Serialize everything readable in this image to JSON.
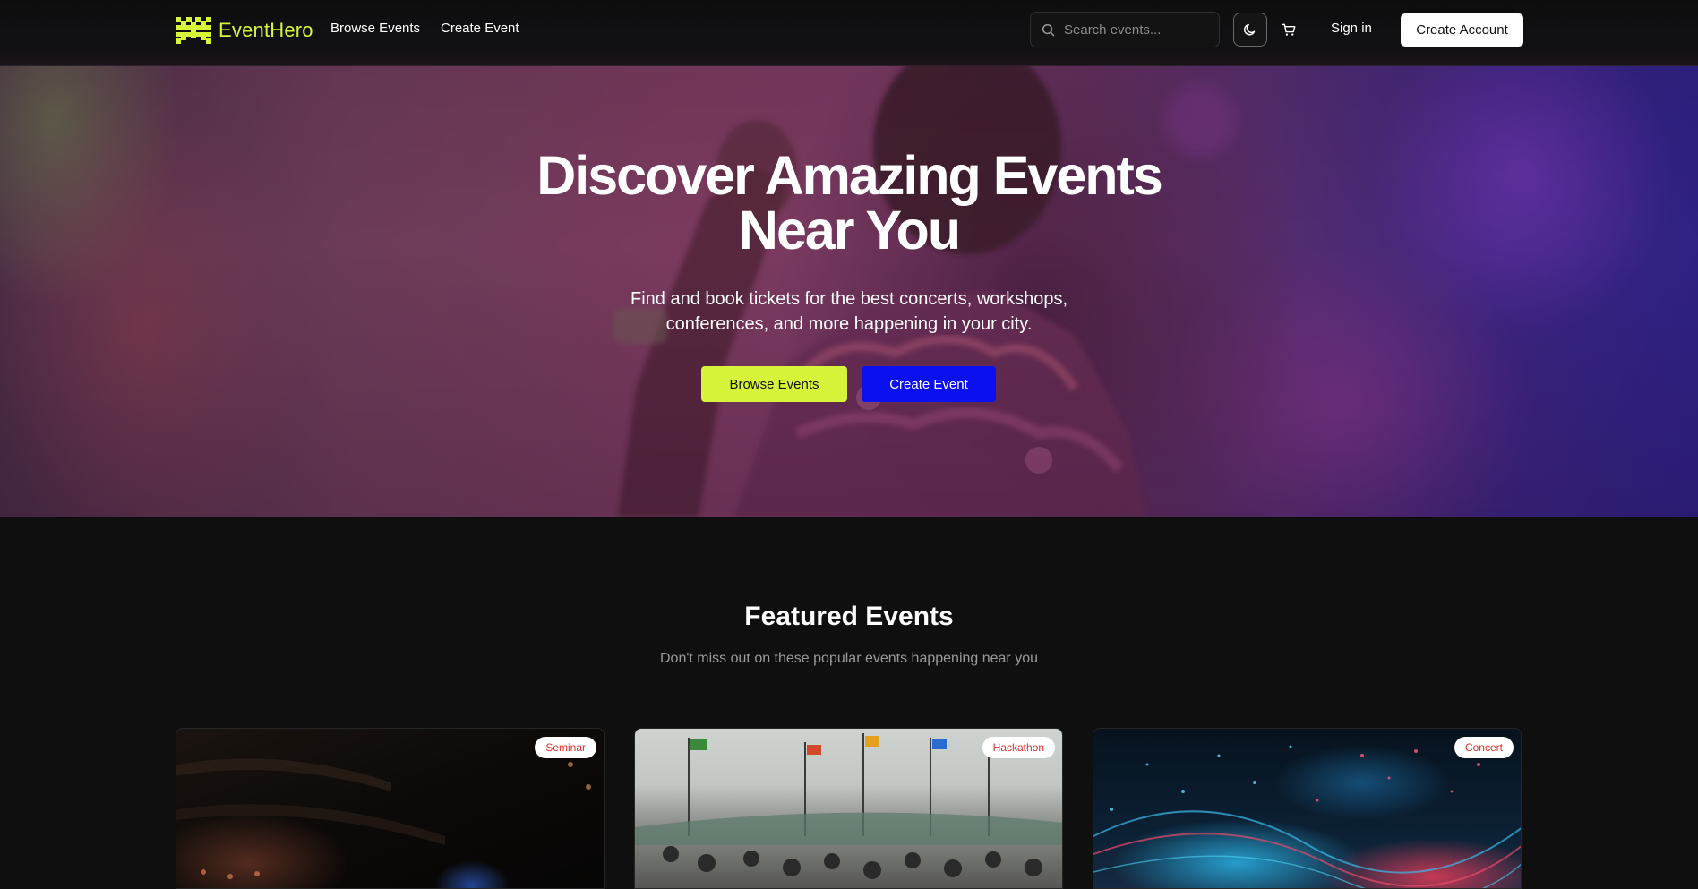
{
  "brand": {
    "name": "EventHero",
    "accent": "#d8f43a"
  },
  "nav": {
    "browse": "Browse Events",
    "create": "Create Event",
    "search_placeholder": "Search events...",
    "signin": "Sign in",
    "create_account": "Create Account",
    "theme_icon": "moon-icon",
    "cart_icon": "cart-icon"
  },
  "hero": {
    "title_line1": "Discover Amazing Events",
    "title_line2": "Near You",
    "subtitle_line1": "Find and book tickets for the best concerts, workshops,",
    "subtitle_line2": "conferences, and more happening in your city.",
    "browse_button": "Browse Events",
    "create_button": "Create Event",
    "browse_color": "#d8f43a",
    "create_color": "#0a10f0"
  },
  "featured": {
    "title": "Featured Events",
    "subtitle": "Don't miss out on these popular events happening near you",
    "cards": [
      {
        "category": "Seminar"
      },
      {
        "category": "Hackathon"
      },
      {
        "category": "Concert"
      }
    ],
    "badge_text_color": "#e0302b"
  }
}
